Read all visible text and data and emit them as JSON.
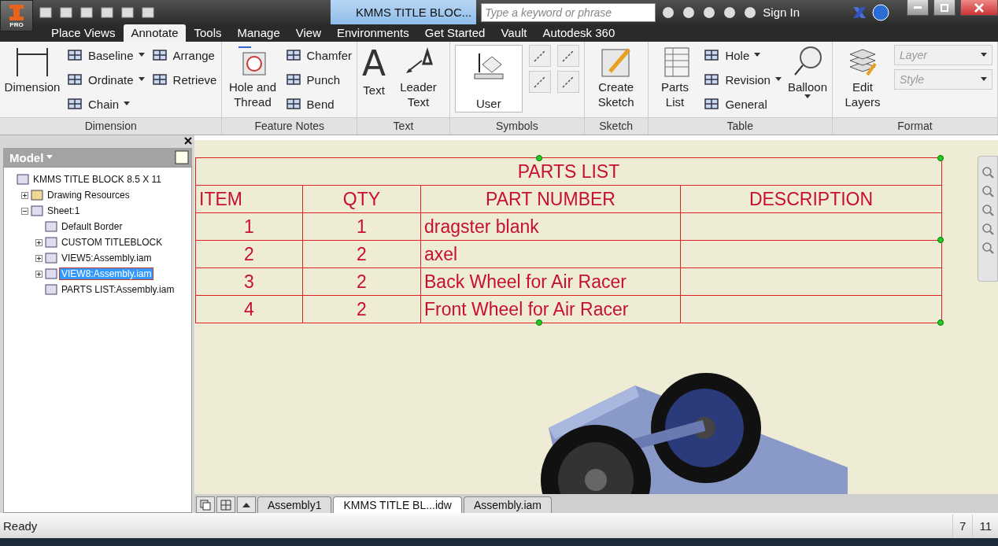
{
  "title_bar": {
    "app_badge": "PRO",
    "document_title": "KMMS TITLE BLOC...",
    "search": {
      "placeholder": "Type a keyword or phrase"
    },
    "sign_in": "Sign In"
  },
  "ribbon_tabs": [
    {
      "label": "Place Views",
      "selected": false
    },
    {
      "label": "Annotate",
      "selected": true
    },
    {
      "label": "Tools",
      "selected": false
    },
    {
      "label": "Manage",
      "selected": false
    },
    {
      "label": "View",
      "selected": false
    },
    {
      "label": "Environments",
      "selected": false
    },
    {
      "label": "Get Started",
      "selected": false
    },
    {
      "label": "Vault",
      "selected": false
    },
    {
      "label": "Autodesk 360",
      "selected": false
    }
  ],
  "ribbon_panels": [
    {
      "title": "Dimension",
      "columns": [
        [
          {
            "kind": "large",
            "label": "Dimension"
          }
        ],
        [
          {
            "kind": "small",
            "label": "Baseline",
            "dropdown": true
          },
          {
            "kind": "small",
            "label": "Ordinate",
            "dropdown": true
          },
          {
            "kind": "small",
            "label": "Chain",
            "dropdown": true
          }
        ],
        [
          {
            "kind": "small",
            "label": "Arrange"
          },
          {
            "kind": "small",
            "label": "Retrieve"
          }
        ]
      ]
    },
    {
      "title": "Feature Notes",
      "columns": [
        [
          {
            "kind": "large",
            "label": "Hole and Thread"
          }
        ],
        [
          {
            "kind": "small",
            "label": "Chamfer"
          },
          {
            "kind": "small",
            "label": "Punch"
          },
          {
            "kind": "small",
            "label": "Bend"
          }
        ]
      ]
    },
    {
      "title": "Text",
      "columns": [
        [
          {
            "kind": "glyph",
            "glyph": "A",
            "label": "Text"
          }
        ],
        [
          {
            "kind": "large",
            "label": "Leader Text"
          }
        ]
      ]
    },
    {
      "title": "Symbols",
      "columns": [
        [
          {
            "kind": "gallery",
            "label": "User"
          }
        ],
        [
          {
            "kind": "icon"
          },
          {
            "kind": "icon"
          }
        ],
        [
          {
            "kind": "icon"
          },
          {
            "kind": "icon"
          }
        ]
      ]
    },
    {
      "title": "Sketch",
      "columns": [
        [
          {
            "kind": "large",
            "label": "Create Sketch"
          }
        ]
      ]
    },
    {
      "title": "Table",
      "columns": [
        [
          {
            "kind": "large",
            "label": "Parts List"
          }
        ],
        [
          {
            "kind": "small",
            "label": "Hole",
            "dropdown": true
          },
          {
            "kind": "small",
            "label": "Revision",
            "dropdown": true
          },
          {
            "kind": "small",
            "label": "General"
          }
        ],
        [
          {
            "kind": "large",
            "label": "Balloon",
            "dropdown": true
          }
        ]
      ]
    },
    {
      "title": "Format",
      "columns": [
        [
          {
            "kind": "large",
            "label": "Edit Layers"
          }
        ],
        [
          {
            "kind": "combo",
            "placeholder": "Layer"
          },
          {
            "kind": "combo",
            "placeholder": "Style"
          }
        ]
      ]
    }
  ],
  "browser": {
    "title": "Model",
    "tree": [
      {
        "label": "KMMS TITLE BLOCK 8.5 X 11",
        "selected": false,
        "children": [
          {
            "label": "Drawing Resources",
            "selected": false,
            "expanded": false
          },
          {
            "label": "Sheet:1",
            "selected": false,
            "expanded": true,
            "children": [
              {
                "label": "Default Border",
                "selected": false
              },
              {
                "label": "CUSTOM TITLEBLOCK",
                "selected": false,
                "expanded": false
              },
              {
                "label": "VIEW5:Assembly.iam",
                "selected": false,
                "expanded": false
              },
              {
                "label": "VIEW8:Assembly.iam",
                "selected": true,
                "expanded": false
              },
              {
                "label": "PARTS LIST:Assembly.iam",
                "selected": false
              }
            ]
          }
        ]
      }
    ]
  },
  "parts_list": {
    "selected": true,
    "title": "PARTS LIST",
    "columns": [
      "ITEM",
      "QTY",
      "PART NUMBER",
      "DESCRIPTION"
    ],
    "rows": [
      [
        "1",
        "1",
        "dragster blank",
        null
      ],
      [
        "2",
        "2",
        "axel",
        null
      ],
      [
        "3",
        "2",
        "Back Wheel for Air Racer",
        null
      ],
      [
        "4",
        "2",
        "Front Wheel for Air Racer",
        null
      ]
    ]
  },
  "document_tabs": [
    {
      "label": "Assembly1",
      "selected": false
    },
    {
      "label": "KMMS TITLE BL...idw",
      "selected": true
    },
    {
      "label": "Assembly.iam",
      "selected": false
    }
  ],
  "status_bar": {
    "text": "Ready",
    "page": "7",
    "count": "11"
  }
}
